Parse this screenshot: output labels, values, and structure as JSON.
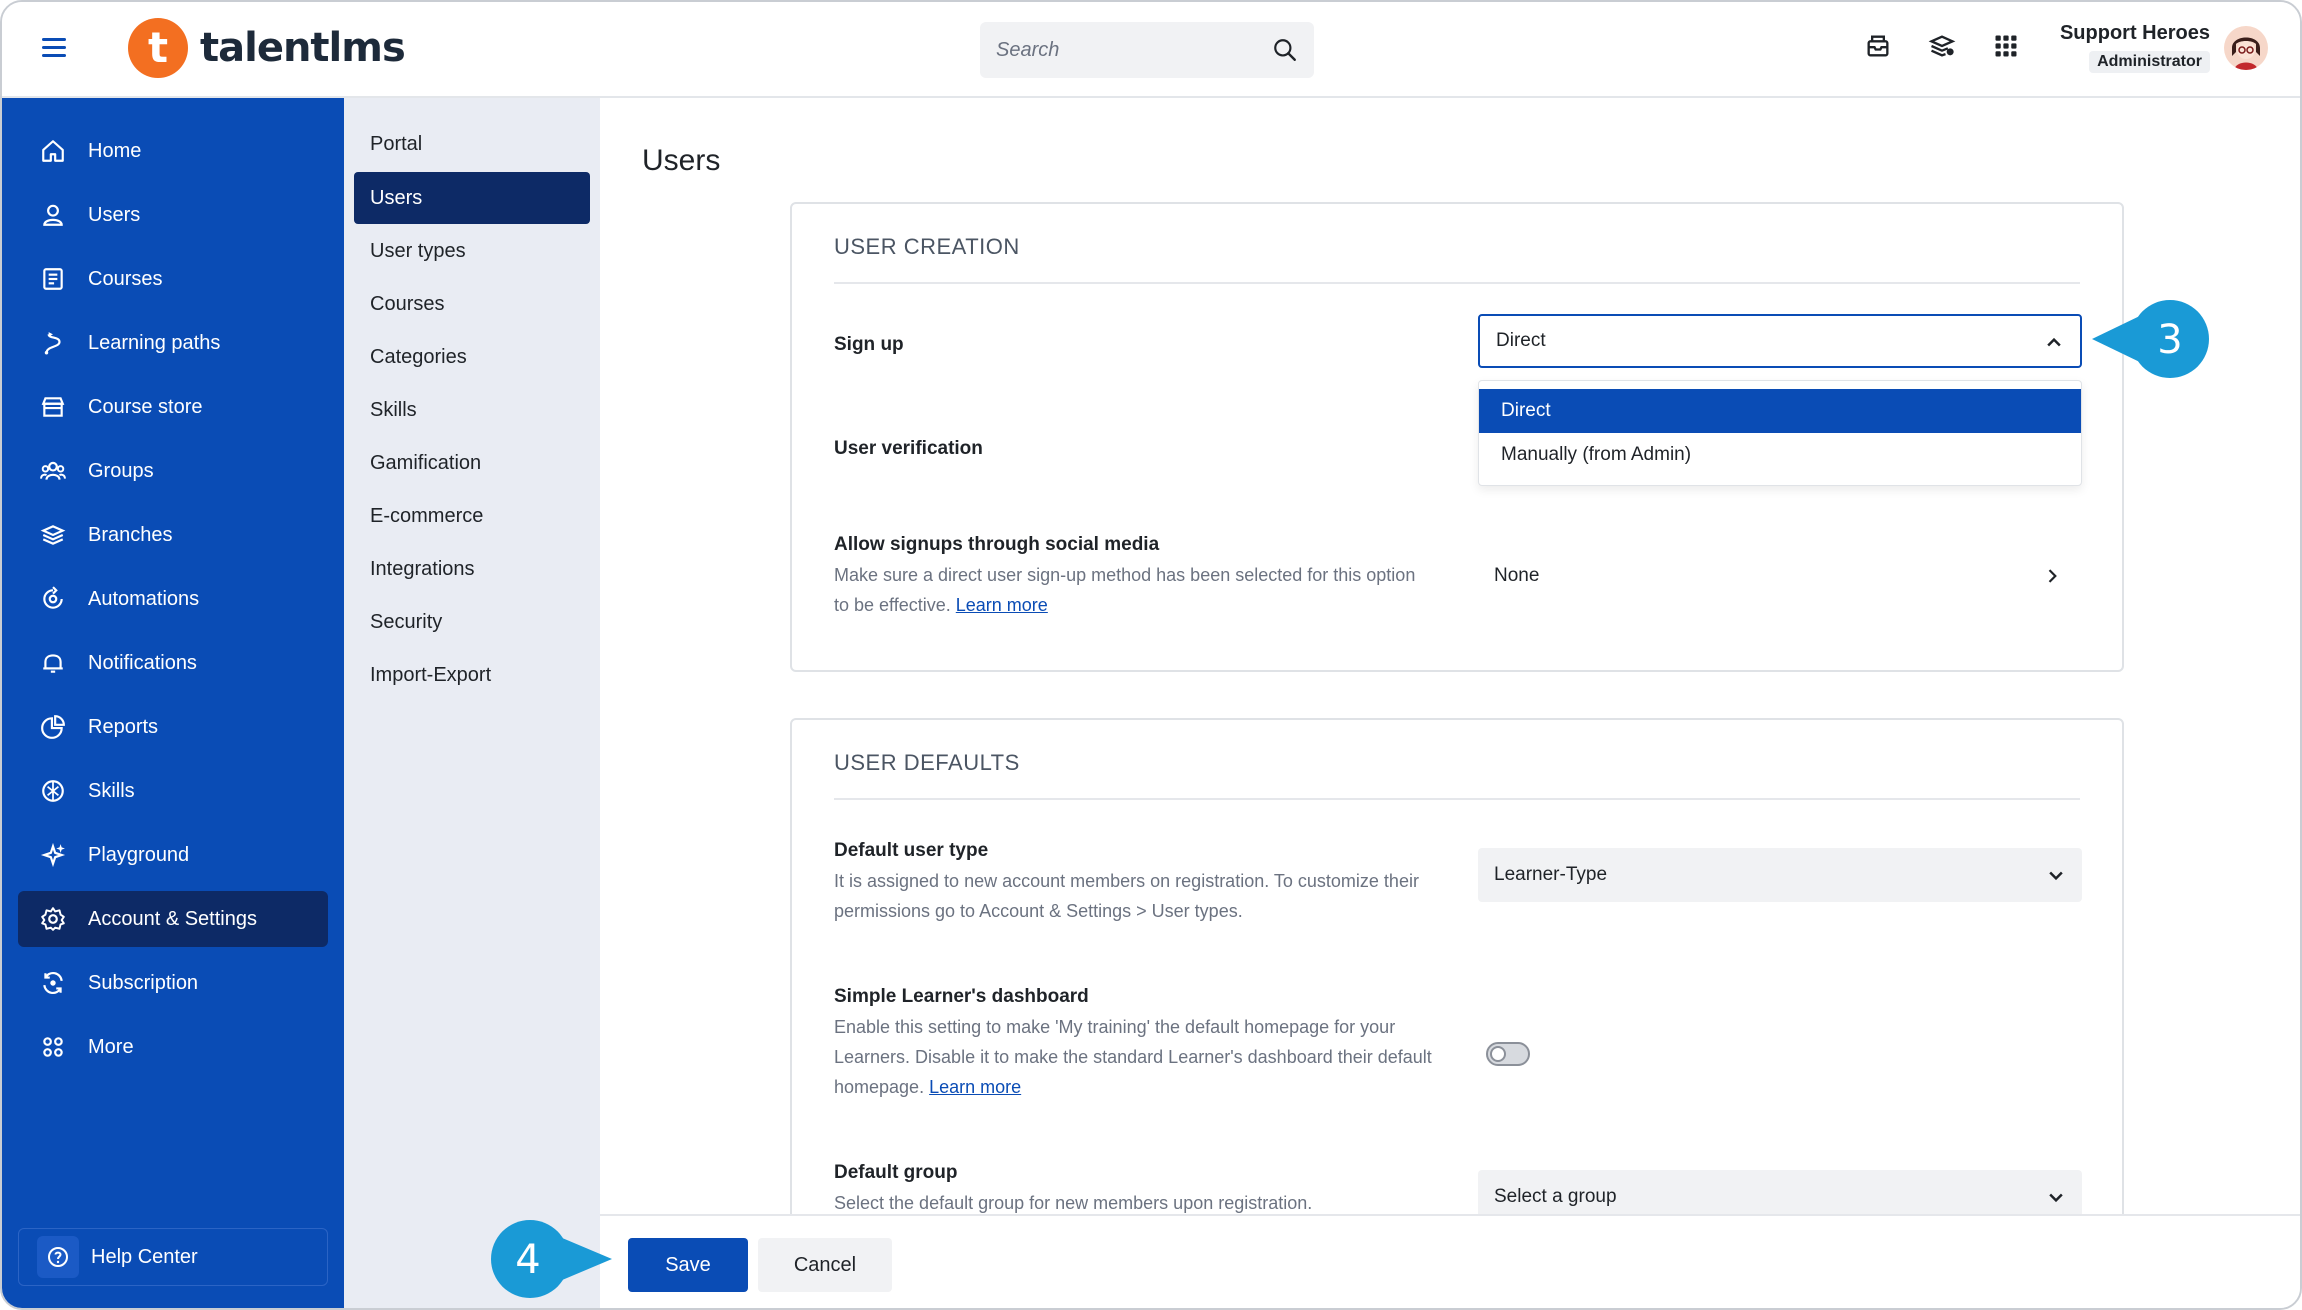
{
  "app": {
    "logo_text": "talentlms",
    "logo_letter": "t",
    "brand_color": "#0a4cb5",
    "logo_color": "#f36f21"
  },
  "header": {
    "search_placeholder": "Search",
    "icons": [
      "messages-icon",
      "catalog-icon",
      "apps-grid-icon"
    ],
    "user_name": "Support Heroes",
    "user_role": "Administrator"
  },
  "sidebar": {
    "items": [
      {
        "label": "Home",
        "icon": "home-icon"
      },
      {
        "label": "Users",
        "icon": "user-icon"
      },
      {
        "label": "Courses",
        "icon": "courses-icon"
      },
      {
        "label": "Learning paths",
        "icon": "learning-paths-icon"
      },
      {
        "label": "Course store",
        "icon": "store-icon"
      },
      {
        "label": "Groups",
        "icon": "groups-icon"
      },
      {
        "label": "Branches",
        "icon": "branches-icon"
      },
      {
        "label": "Automations",
        "icon": "automations-icon"
      },
      {
        "label": "Notifications",
        "icon": "notifications-icon"
      },
      {
        "label": "Reports",
        "icon": "reports-icon"
      },
      {
        "label": "Skills",
        "icon": "skills-icon"
      },
      {
        "label": "Playground",
        "icon": "playground-icon"
      },
      {
        "label": "Account & Settings",
        "icon": "settings-icon",
        "active": true
      },
      {
        "label": "Subscription",
        "icon": "subscription-icon"
      },
      {
        "label": "More",
        "icon": "more-icon"
      }
    ],
    "help_center": "Help Center"
  },
  "subnav": {
    "items": [
      "Portal",
      "Users",
      "User types",
      "Courses",
      "Categories",
      "Skills",
      "Gamification",
      "E-commerce",
      "Integrations",
      "Security",
      "Import-Export"
    ],
    "active": "Users"
  },
  "main": {
    "title": "Users",
    "user_creation": {
      "heading": "USER CREATION",
      "signup_label": "Sign up",
      "signup_value": "Direct",
      "signup_options": [
        "Direct",
        "Manually (from Admin)"
      ],
      "verification_label": "User verification",
      "social_label": "Allow signups through social media",
      "social_desc": "Make sure a direct user sign-up method has been selected for this option to be effective.",
      "social_link": "Learn more",
      "social_value": "None"
    },
    "user_defaults": {
      "heading": "USER DEFAULTS",
      "default_type_label": "Default user type",
      "default_type_desc": "It is assigned to new account members on registration. To customize their permissions go to Account & Settings > User types.",
      "default_type_value": "Learner-Type",
      "dashboard_label": "Simple Learner's dashboard",
      "dashboard_desc": "Enable this setting to make 'My training' the default homepage for your Learners. Disable it to make the standard Learner's dashboard their default homepage.",
      "dashboard_link": "Learn more",
      "dashboard_enabled": false,
      "default_group_label": "Default group",
      "default_group_desc": "Select the default group for new members upon registration.",
      "default_group_value": "Select a group"
    }
  },
  "footer": {
    "save": "Save",
    "cancel": "Cancel"
  },
  "callouts": {
    "step3": "3",
    "step4": "4",
    "color": "#1a9ad6"
  }
}
